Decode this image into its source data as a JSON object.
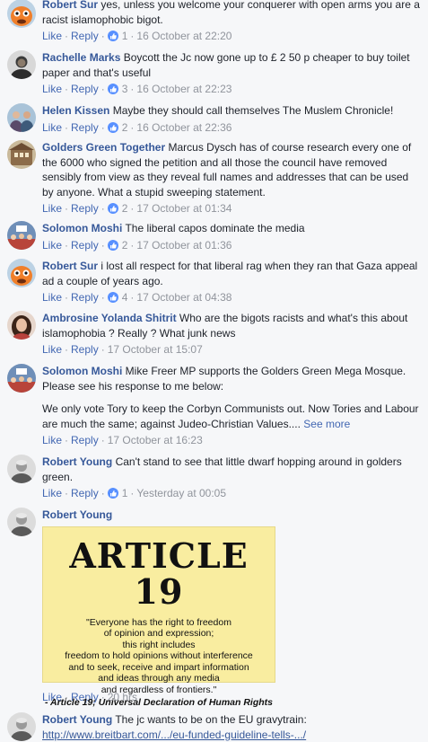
{
  "labels": {
    "like": "Like",
    "reply": "Reply"
  },
  "colors": {
    "author": "#365899",
    "action": "#4267b2",
    "like_badge": "#5890ff",
    "background": "#f6f7f9"
  },
  "comments": [
    {
      "avatar_icon": "puppet-avatar-icon",
      "author": "Robert Sur",
      "text": "yes, unless you welcome your conquerer with open arms you are a racist islamophobic bigot.",
      "likes": "1",
      "time": "16 October at 22:20"
    },
    {
      "avatar_icon": "man-avatar-icon",
      "author": "Rachelle Marks",
      "text": "Boycott the Jc now gone up to £ 2 50 p cheaper to buy toilet paper and that's useful",
      "likes": "3",
      "time": "16 October at 22:23"
    },
    {
      "avatar_icon": "group-avatar-icon",
      "author": "Helen Kissen",
      "text": "Maybe they should call themselves The Muslem Chronicle!",
      "likes": "2",
      "time": "16 October at 22:36"
    },
    {
      "avatar_icon": "building-avatar-icon",
      "author": "Golders Green Together",
      "text": "Marcus Dysch has of course research every one of the 6000 who signed the petition and all those the council have removed sensibly from view as they reveal full names and addresses that can be used by anyone. What a stupid sweeping statement.",
      "likes": "2",
      "time": "17 October at 01:34"
    },
    {
      "avatar_icon": "crowd-avatar-icon",
      "author": "Solomon Moshi",
      "text": "The liberal capos dominate the media",
      "likes": "2",
      "time": "17 October at 01:36"
    },
    {
      "avatar_icon": "puppet-avatar-icon",
      "author": "Robert Sur",
      "text": "i lost all respect for that liberal rag when they ran that Gaza appeal ad a couple of years ago.",
      "likes": "4",
      "time": "17 October at 04:38"
    },
    {
      "avatar_icon": "woman-avatar-icon",
      "author": "Ambrosine Yolanda Shitrit",
      "text": "Who are the bigots racists and what's this about islamophobia ? Really ? What junk news",
      "time": "17 October at 15:07"
    },
    {
      "avatar_icon": "crowd-avatar-icon",
      "author": "Solomon Moshi",
      "text": "Mike Freer MP supports the Golders Green Mega Mosque. Please see his response to me below:",
      "text2": "We only vote Tory to keep the Corbyn Communists out. Now Tories and Labour are much the same; against Judeo-Christian Values....",
      "see_more": "See more",
      "time": "17 October at 16:23"
    },
    {
      "avatar_icon": "elder-avatar-icon",
      "author": "Robert Young",
      "text": "Can't stand to see that little dwarf hopping around in golders green.",
      "likes": "1",
      "time": "Yesterday at 00:05"
    },
    {
      "avatar_icon": "elder-avatar-icon",
      "author": "Robert Young",
      "image": {
        "title": "ARTICLE 19",
        "quote_lines": [
          "\"Everyone has the right to freedom",
          "of opinion and expression;",
          "this right includes",
          "freedom to hold opinions without interference",
          "and to seek, receive and impart information",
          "and ideas through any media",
          "and regardless of frontiers.\""
        ],
        "citation": "- Article 19; Universal Declaration of Human Rights"
      },
      "time": "20 hrs"
    },
    {
      "avatar_icon": "elder-avatar-icon",
      "author": "Robert Young",
      "text": "The jc wants to be on the EU gravytrain:",
      "link": "http://www.breitbart.com/.../eu-funded-guideline-tells-.../"
    }
  ]
}
